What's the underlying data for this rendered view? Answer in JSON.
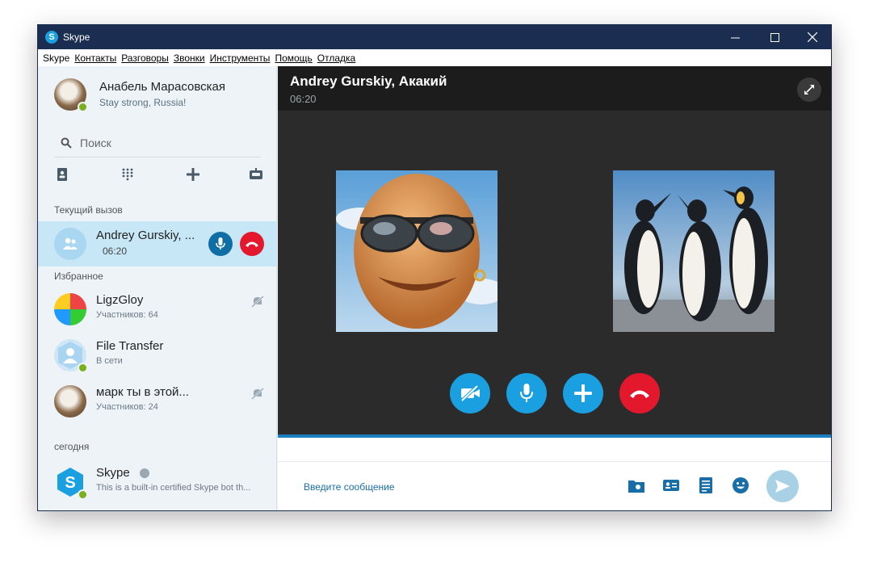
{
  "window": {
    "title": "Skype"
  },
  "menu": [
    {
      "label": "Skype",
      "accent_index": 0
    },
    {
      "label": "Контакты",
      "accent_index": 0
    },
    {
      "label": "Разговоры",
      "accent_index": 0
    },
    {
      "label": "Звонки",
      "accent_index": 0
    },
    {
      "label": "Инструменты",
      "accent_index": 0
    },
    {
      "label": "Помощь",
      "accent_index": 0
    },
    {
      "label": "Отладка",
      "accent_index": 0
    }
  ],
  "profile": {
    "name": "Анабель Марасовская",
    "mood": "Stay strong, Russia!",
    "status": "online"
  },
  "search": {
    "placeholder": "Поиск"
  },
  "toolbar_icons": [
    "contacts-book-icon",
    "dialpad-icon",
    "add-icon",
    "bot-icon"
  ],
  "sections": {
    "current_call": "Текущий вызов",
    "favorites": "Избранное",
    "today": "сегодня"
  },
  "current_call": {
    "name": "Andrey Gurskiy, ...",
    "duration": "06:20"
  },
  "favorites": [
    {
      "name": "LigzGloy",
      "sub": "Участников: 64",
      "muted": true
    },
    {
      "name": "File Transfer",
      "sub": "В сети",
      "muted": false
    },
    {
      "name": "марк ты в этой...",
      "sub": "Участников: 24",
      "muted": true
    }
  ],
  "today": [
    {
      "name": "Skype",
      "sub": "This is a built-in certified Skype bot th..."
    }
  ],
  "call_header": {
    "title": "Andrey Gurskiy, Акакий",
    "duration": "06:20"
  },
  "compose": {
    "placeholder": "Введите сообщение"
  },
  "colors": {
    "titlebar": "#1b2e52",
    "accent_blue": "#1aa0e0",
    "hangup_red": "#e3182d",
    "selected_row": "#c7e7f7",
    "stage": "#2b2b2b"
  }
}
